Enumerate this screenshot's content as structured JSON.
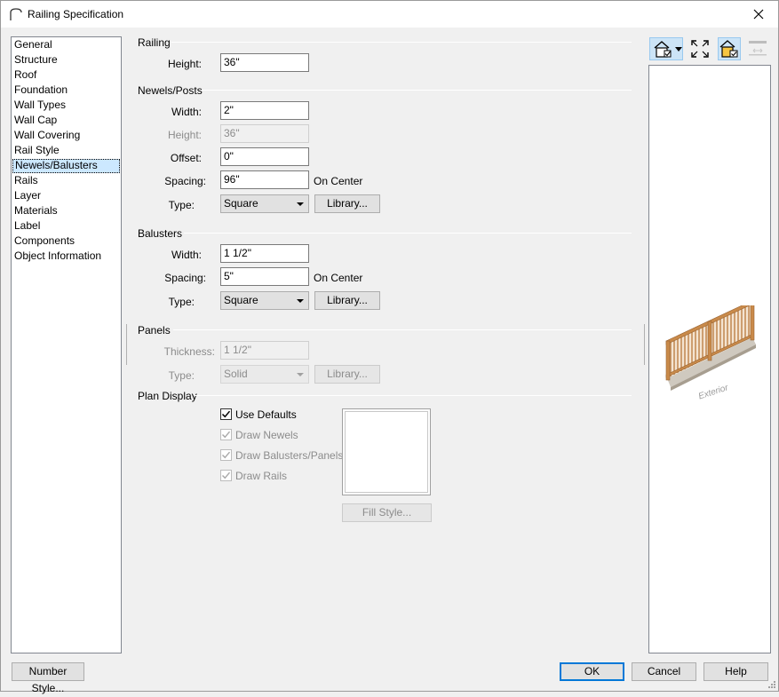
{
  "window": {
    "title": "Railing Specification"
  },
  "nav": {
    "items": [
      "General",
      "Structure",
      "Roof",
      "Foundation",
      "Wall Types",
      "Wall Cap",
      "Wall Covering",
      "Rail Style",
      "Newels/Balusters",
      "Rails",
      "Layer",
      "Materials",
      "Label",
      "Components",
      "Object Information"
    ],
    "selected": "Newels/Balusters"
  },
  "railing": {
    "title": "Railing",
    "height_label": "Height:",
    "height_value": "36\""
  },
  "newels": {
    "title": "Newels/Posts",
    "width_label": "Width:",
    "width_value": "2\"",
    "height_label": "Height:",
    "height_value": "36\"",
    "offset_label": "Offset:",
    "offset_value": "0\"",
    "spacing_label": "Spacing:",
    "spacing_value": "96\"",
    "spacing_suffix": "On Center",
    "type_label": "Type:",
    "type_value": "Square",
    "library_label": "Library..."
  },
  "balusters": {
    "title": "Balusters",
    "width_label": "Width:",
    "width_value": "1 1/2\"",
    "spacing_label": "Spacing:",
    "spacing_value": "5\"",
    "spacing_suffix": "On Center",
    "type_label": "Type:",
    "type_value": "Square",
    "library_label": "Library..."
  },
  "panels": {
    "title": "Panels",
    "thickness_label": "Thickness:",
    "thickness_value": "1 1/2\"",
    "type_label": "Type:",
    "type_value": "Solid",
    "library_label": "Library..."
  },
  "plan_display": {
    "title": "Plan Display",
    "use_defaults": "Use Defaults",
    "draw_newels": "Draw Newels",
    "draw_balusters": "Draw Balusters/Panels",
    "draw_rails": "Draw Rails",
    "fill_style": "Fill Style..."
  },
  "preview": {
    "label": "Exterior"
  },
  "footer": {
    "number_style": "Number Style...",
    "ok": "OK",
    "cancel": "Cancel",
    "help": "Help"
  },
  "colors": {
    "accent": "#0078d7",
    "selection": "#cce8ff",
    "railing_wood": "#c98a4a"
  }
}
